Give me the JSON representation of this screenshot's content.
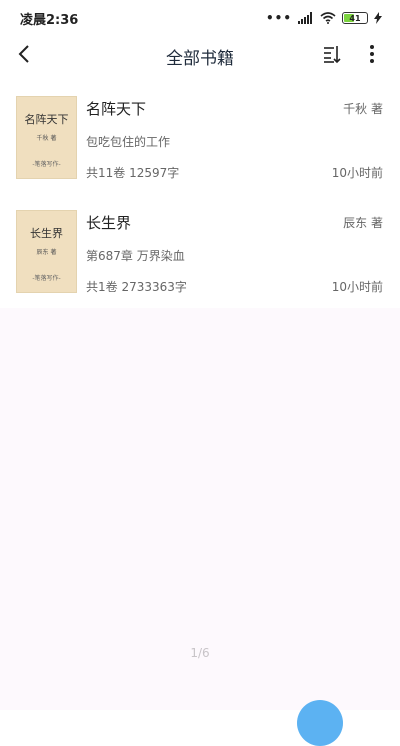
{
  "status_bar": {
    "time": "凌晨2:36",
    "battery": "41"
  },
  "header": {
    "title": "全部书籍"
  },
  "books": [
    {
      "title": "名阵天下",
      "author": "千秋 著",
      "latest": "包吃包住的工作",
      "meta": "共11卷 12597字",
      "updated": "10小时前",
      "cover": {
        "title": "名阵天下",
        "author": "千秋 著",
        "brand": "-笔落写作-"
      }
    },
    {
      "title": "长生界",
      "author": "辰东 著",
      "latest": "第687章 万界染血",
      "meta": "共1卷 2733363字",
      "updated": "10小时前",
      "cover": {
        "title": "长生界",
        "author": "辰东 著",
        "brand": "-笔落写作-"
      }
    }
  ],
  "pagination": {
    "label": "1/6"
  },
  "colors": {
    "accent": "#5cb2f2",
    "cover": "#f0dfbf",
    "background": "#fdf9fd"
  }
}
